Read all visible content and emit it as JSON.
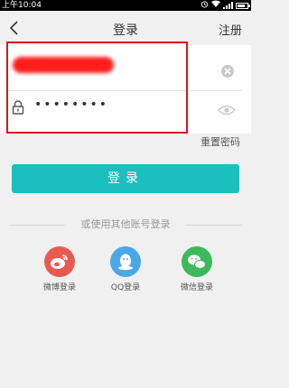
{
  "status_bar": {
    "time": "上午10:04"
  },
  "header": {
    "title": "登录",
    "register_label": "注册"
  },
  "form": {
    "username_value": "",
    "password_value": "••••••••"
  },
  "forgot_password_label": "重置密码",
  "login_button_label": "登录",
  "alternative_login_text": "或使用其他账号登录",
  "social_logins": [
    {
      "label": "微博登录",
      "icon": "weibo-icon",
      "color": "#e85a4f"
    },
    {
      "label": "QQ登录",
      "icon": "qq-icon",
      "color": "#4aa8e8"
    },
    {
      "label": "微信登录",
      "icon": "wechat-icon",
      "color": "#3cb95a"
    }
  ],
  "colors": {
    "accent": "#1bbfbd",
    "annotation_box": "#d11a1a",
    "redaction": "#ff1c1c"
  }
}
